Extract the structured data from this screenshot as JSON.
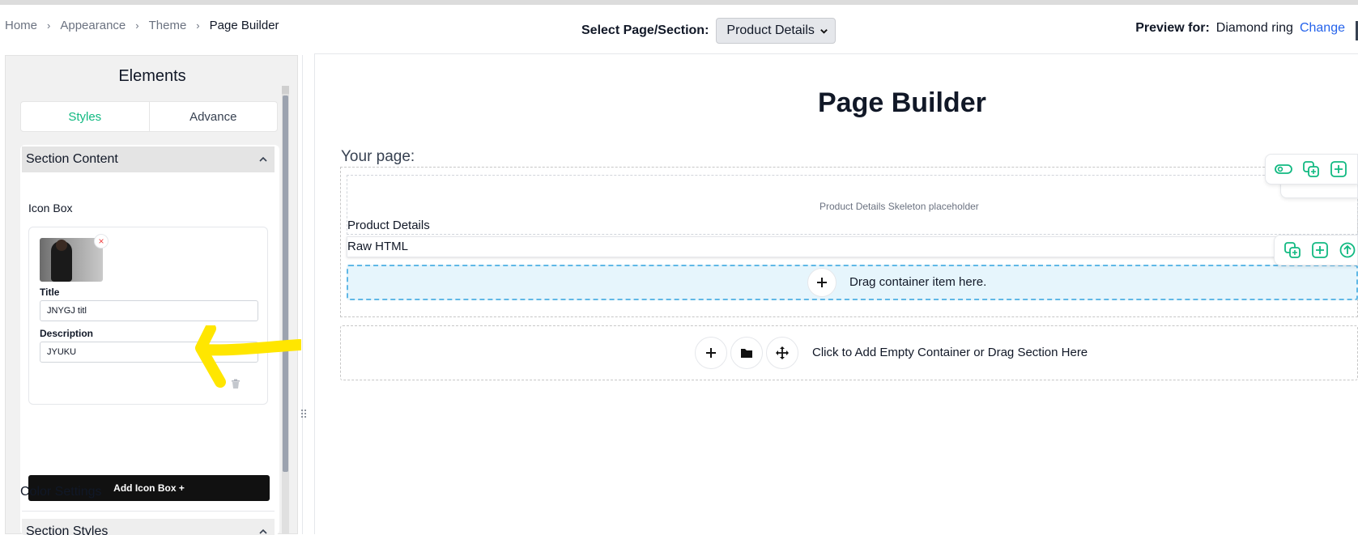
{
  "breadcrumb": {
    "items": [
      "Home",
      "Appearance",
      "Theme",
      "Page Builder"
    ],
    "separator": "›"
  },
  "page_select": {
    "label": "Select Page/Section:",
    "value": "Product Details"
  },
  "preview": {
    "label": "Preview for:",
    "product": "Diamond ring",
    "change_link": "Change"
  },
  "panel": {
    "title": "Elements",
    "tabs": [
      "Styles",
      "Advance"
    ],
    "active_tab": "Styles",
    "section_content": {
      "header": "Section Content",
      "icon_box_label": "Icon Box",
      "title_label": "Title",
      "title_value": "JNYGJ titl",
      "description_label": "Description",
      "description_value": "JYUKU",
      "remove_glyph": "×",
      "add_button": "Add Icon Box +"
    },
    "section_styles": {
      "header": "Section Styles",
      "color_settings": "Color Settings"
    }
  },
  "canvas": {
    "title": "Page Builder",
    "your_page": "Your page:",
    "skeleton_placeholder": "Product Details Skeleton placeholder",
    "product_details_label": "Product Details",
    "raw_html_label": "Raw HTML",
    "drag_container_text": "Drag container item here.",
    "empty_container_text": "Click to Add Empty Container or Drag Section Here"
  },
  "colors": {
    "accent": "#10b981",
    "link": "#2563eb",
    "drop_bg": "#e6f5fc",
    "drop_border": "#60b8e6",
    "annotation_arrow": "#ffe600",
    "primary_button": "#111111"
  },
  "icons": {
    "breadcrumb_separator": "chevron-right-icon",
    "collapse": "chevron-up-icon",
    "delete": "trash-icon",
    "toolbar": [
      "toggle-icon",
      "duplicate-icon",
      "add-square-icon",
      "move-up-icon"
    ],
    "empty_container_actions": [
      "plus-icon",
      "folder-icon",
      "move-icon"
    ]
  }
}
